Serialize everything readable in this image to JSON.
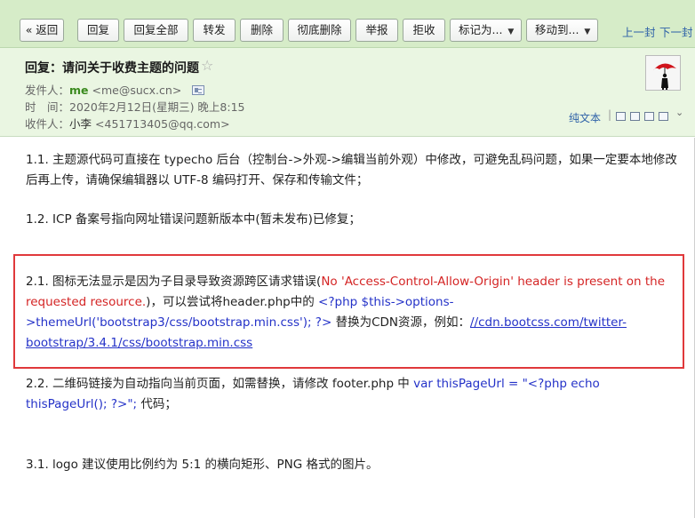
{
  "toolbar": {
    "buttons": [
      {
        "label": "« 返回"
      },
      {
        "label": "回复"
      },
      {
        "label": "回复全部"
      },
      {
        "label": "转发"
      },
      {
        "label": "删除"
      },
      {
        "label": "彻底删除"
      },
      {
        "label": "举报"
      },
      {
        "label": "拒收"
      },
      {
        "label": "标记为..."
      },
      {
        "label": "移动到..."
      }
    ],
    "prev_label": "上一封",
    "next_label": "下一封"
  },
  "header": {
    "subject": "回复：请问关于收费主题的问题",
    "from_label": "发件人：",
    "from_name": "me",
    "from_email": "<me@sucx.cn>",
    "time_label": "时　间：",
    "time_value": "2020年2月12日(星期三) 晚上8:15",
    "to_label": "收件人：",
    "to_name": "小李",
    "to_email": "<451713405@qq.com>",
    "plain_text": "纯文本",
    "separator": "|"
  },
  "body": {
    "p1": "1.1. 主题源代码可直接在 typecho 后台（控制台->外观->编辑当前外观）中修改，可避免乱码问题，如果一定要本地修改后再上传，请确保编辑器以 UTF-8 编码打开、保存和传输文件；",
    "p2": "1.2. ICP 备案号指向网址错误问题新版本中(暂未发布)已修复；",
    "p3_a": "2.1. 图标无法显示是因为子目录导致资源跨区请求错误(",
    "p3_err": "No 'Access-Control-Allow-Origin' header is present on the requested resource.",
    "p3_b": ")，可以尝试将header.php中的 ",
    "p3_code": "<?php $this->options->themeUrl('bootstrap3/css/bootstrap.min.css'); ?>",
    "p3_c": " 替换为CDN资源，例如：",
    "p3_link": "//cdn.bootcss.com/twitter-bootstrap/3.4.1/css/bootstrap.min.css",
    "p4_a": "2.2. 二维码链接为自动指向当前页面，如需替换，请修改 footer.php 中 ",
    "p4_code": "var thisPageUrl = \"<?php echo thisPageUrl(); ?>\";",
    "p4_b": " 代码；",
    "p5": "3.1. logo 建议使用比例约为 5:1 的横向矩形、PNG 格式的图片。"
  }
}
